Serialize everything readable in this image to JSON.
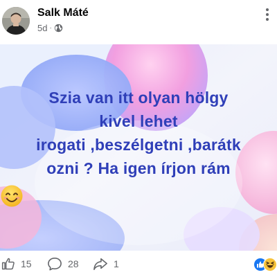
{
  "post": {
    "author": "Salk Máté",
    "time_ago": "5d",
    "visibility_icon": "globe-icon",
    "text": "Szia van itt olyan hölgy\nkivel lehet\nirogati ,beszélgetni ,barátk\nozni ? Ha igen írjon rám",
    "emoji": "😊",
    "background_colors": [
      "#dde4f7",
      "#f2b5e6",
      "#a9b8f8",
      "#f9d6c9"
    ],
    "text_color": "#2f3fb8"
  },
  "actions": {
    "like_icon": "thumbs-up-icon",
    "like_count": "15",
    "comment_icon": "comment-icon",
    "comment_count": "28",
    "share_icon": "share-icon",
    "share_count": "1",
    "reaction_icons": [
      "like-reaction-icon",
      "haha-reaction-icon"
    ],
    "like_color": "#1877f2"
  }
}
